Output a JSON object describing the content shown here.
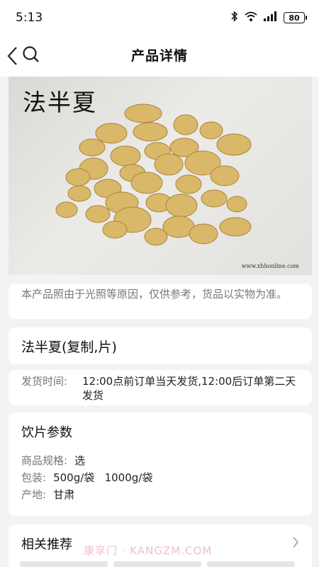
{
  "status_bar": {
    "time": "5:13",
    "bluetooth_icon": "bluetooth-icon",
    "wifi_icon": "wifi-icon",
    "signal_icon": "signal-icon",
    "battery_level": "80"
  },
  "nav": {
    "title": "产品详情",
    "back_icon": "back-icon",
    "search_icon": "search-icon"
  },
  "product_image": {
    "title": "法半夏",
    "watermark": "www.xhhonline.com"
  },
  "notice": {
    "text": "本产品照由于光照等原因，仅供参考，货品以实物为准。"
  },
  "product": {
    "name": "法半夏(复制,片)"
  },
  "shipping": {
    "label": "发货时间:",
    "value": "12:00点前订单当天发货,12:00后订单第二天发货"
  },
  "params": {
    "title": "饮片参数",
    "rows": [
      {
        "label": "商品规格:",
        "value": "选"
      },
      {
        "label": "包装:",
        "value": "500g/袋   1000g/袋"
      },
      {
        "label": "产地:",
        "value": "甘肃"
      }
    ]
  },
  "recommend": {
    "title": "相关推荐",
    "watermark": "康享门 · KANGZM.COM"
  }
}
